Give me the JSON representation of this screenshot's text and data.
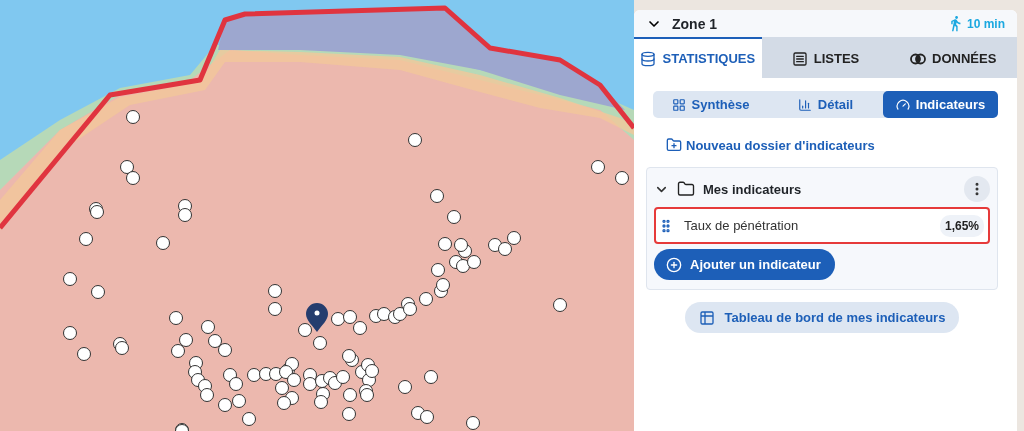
{
  "zone": {
    "title": "Zone 1",
    "expanded": true,
    "travel_time": "10 min"
  },
  "tabs": [
    {
      "label": "STATISTIQUES",
      "selected": true
    },
    {
      "label": "LISTES",
      "selected": false
    },
    {
      "label": "DONNÉES",
      "selected": false
    }
  ],
  "subtabs": [
    {
      "label": "Synthèse",
      "selected": false
    },
    {
      "label": "Détail",
      "selected": false
    },
    {
      "label": "Indicateurs",
      "selected": true
    }
  ],
  "new_folder_link": "Nouveau dossier d'indicateurs",
  "folder": {
    "name": "Mes indicateurs",
    "expanded": true,
    "indicators": [
      {
        "name": "Taux de pénétration",
        "value": "1,65%",
        "selected": true
      }
    ],
    "add_button": "Ajouter un indicateur"
  },
  "dashboard_button": "Tableau de bord de mes indicateurs"
}
